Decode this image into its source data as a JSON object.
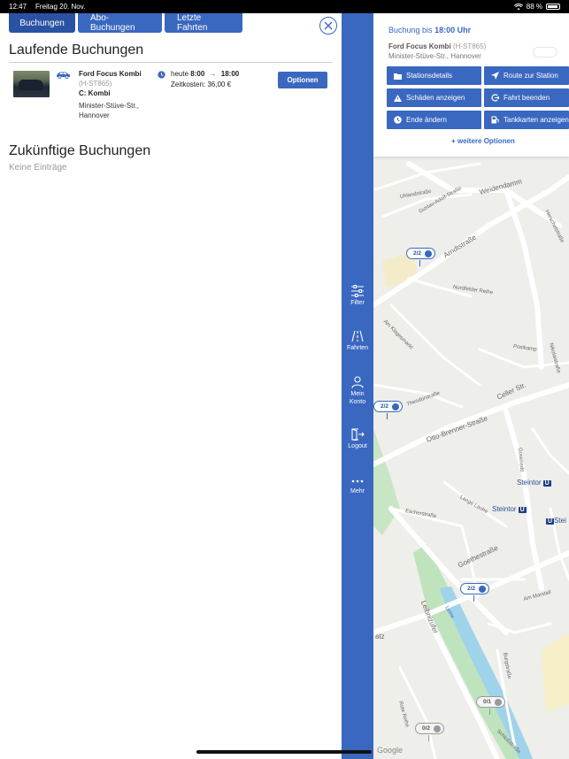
{
  "status_bar": {
    "time": "12:47",
    "date": "Freitag 20. Nov.",
    "battery": "88 %"
  },
  "tabs": [
    {
      "label": "Buchungen",
      "active": true
    },
    {
      "label": "Abo-Buchungen",
      "active": false
    },
    {
      "label": "Letzte Fahrten",
      "active": false
    }
  ],
  "current": {
    "heading": "Laufende Buchungen",
    "booking": {
      "vehicle_name": "Ford Focus Kombi",
      "plate": "(H-ST865)",
      "vehicle_class": "C: Kombi",
      "address": "Minister-Stüve-Str., Hannover",
      "time_prefix": "heute",
      "time_start": "8:00",
      "time_end": "18:00",
      "cost": "Zeitkosten:  36,00 €",
      "options_label": "Optionen"
    }
  },
  "future": {
    "heading": "Zukünftige Buchungen",
    "empty": "Keine Einträge"
  },
  "sidebar": {
    "items": [
      {
        "label": "Filter",
        "icon": "filter-icon"
      },
      {
        "label": "Fahrten",
        "icon": "road-icon"
      },
      {
        "label": "Mein Konto",
        "icon": "account-icon"
      },
      {
        "label": "Logout",
        "icon": "logout-icon"
      },
      {
        "label": "Mehr",
        "icon": "more-icon"
      }
    ]
  },
  "map_card": {
    "title_prefix": "Buchung bis",
    "title_time": "18:00 Uhr",
    "vehicle_name": "Ford Focus Kombi",
    "plate": "(H-ST865)",
    "address": "Minister-Stüve-Str., Hannover",
    "buttons": [
      {
        "label": "Stationsdetails",
        "icon": "folder-icon"
      },
      {
        "label": "Route zur Station",
        "icon": "navigation-icon"
      },
      {
        "label": "Schäden anzeigen",
        "icon": "warning-icon"
      },
      {
        "label": "Fahrt beenden",
        "icon": "end-trip-icon"
      },
      {
        "label": "Ende ändern",
        "icon": "clock-icon"
      },
      {
        "label": "Tankkarten anzeigen",
        "icon": "fuel-icon"
      }
    ],
    "more_options": "+ weitere Optionen"
  },
  "map": {
    "streets": [
      "Weidendamm",
      "Arndtstraße",
      "Herschelstraße",
      "Gustav-Adolf-Straße",
      "Uhlandstraße",
      "Nordfelder Reihe",
      "Am Klagesmarkt",
      "Postkamp",
      "Nikolaistraße",
      "Theodorstraße",
      "Otto-Brenner-Straße",
      "Celler Str.",
      "Goseriede",
      "Lange Laube",
      "Escherstraße",
      "Goethestraße",
      "Leibnizufer",
      "Leine",
      "Am Marstall",
      "Burgstraße",
      "Rote Reihe",
      "Schloßstraße",
      "Ernst-August-Platz"
    ],
    "stations": [
      "Steintor",
      "Steintor",
      "Stei"
    ],
    "pins": [
      {
        "label": "2/2",
        "state": "available"
      },
      {
        "label": "2/2",
        "state": "available"
      },
      {
        "label": "2/2",
        "state": "available"
      },
      {
        "label": "0/1",
        "state": "unavailable"
      },
      {
        "label": "0/2",
        "state": "unavailable"
      }
    ],
    "attribution": "Google"
  }
}
